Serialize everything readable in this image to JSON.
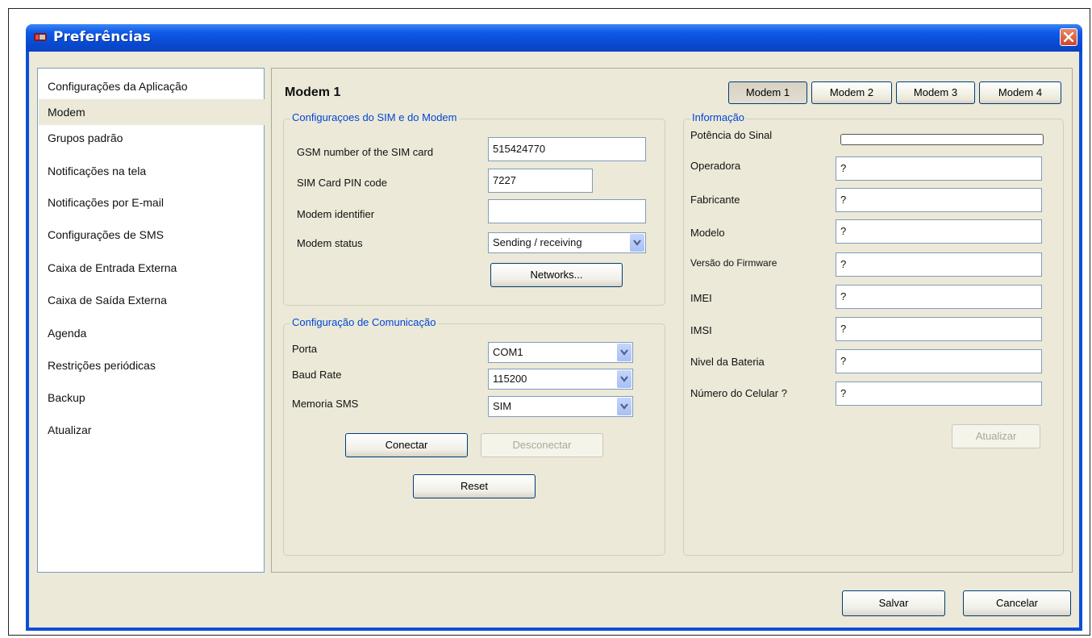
{
  "window": {
    "title": "Preferências"
  },
  "nav": {
    "items": [
      {
        "label": "Configurações da Aplicação"
      },
      {
        "label": "Modem",
        "selected": true
      },
      {
        "label": "Grupos padrão"
      },
      {
        "label": "Notificações na tela"
      },
      {
        "label": "Notificações por E-mail"
      },
      {
        "label": "Configurações de SMS"
      },
      {
        "label": "Caixa de Entrada Externa"
      },
      {
        "label": "Caixa de Saída Externa"
      },
      {
        "label": "Agenda"
      },
      {
        "label": "Restrições periódicas"
      },
      {
        "label": "Backup"
      },
      {
        "label": "Atualizar"
      }
    ]
  },
  "main": {
    "title": "Modem 1",
    "tabs": [
      {
        "label": "Modem 1",
        "active": true
      },
      {
        "label": "Modem 2"
      },
      {
        "label": "Modem 3"
      },
      {
        "label": "Modem 4"
      }
    ]
  },
  "sim_group": {
    "title": "Configuraçoes do SIM e do Modem",
    "gsm_label": "GSM number of the SIM card",
    "gsm_value": "515424770",
    "pin_label": "SIM Card PIN code",
    "pin_value": "7227",
    "modem_id_label": "Modem identifier",
    "modem_id_value": "",
    "status_label": "Modem status",
    "status_value": "Sending / receiving",
    "networks_button": "Networks..."
  },
  "comm_group": {
    "title": "Configuração de Comunicação",
    "port_label": "Porta",
    "port_value": "COM1",
    "baud_label": "Baud Rate",
    "baud_value": "115200",
    "memory_label": "Memoria SMS",
    "memory_value": "SIM",
    "connect_button": "Conectar",
    "disconnect_button": "Desconectar",
    "reset_button": "Reset"
  },
  "info_group": {
    "title": "Informação",
    "signal_label": "Potência do Sinal",
    "signal_level": 0,
    "rows": [
      {
        "label": "Operadora",
        "value": "?"
      },
      {
        "label": "Fabricante",
        "value": "?"
      },
      {
        "label": "Modelo",
        "value": "?"
      },
      {
        "label": "Versão do Firmware",
        "value": "?"
      },
      {
        "label": "IMEI",
        "value": "?"
      },
      {
        "label": "IMSI",
        "value": "?"
      },
      {
        "label": "Nivel da Bateria",
        "value": "?"
      },
      {
        "label": "Número do Celular ?",
        "value": "?"
      }
    ],
    "update_button": "Atualizar"
  },
  "footer": {
    "save_button": "Salvar",
    "cancel_button": "Cancelar"
  },
  "colors": {
    "titlebar": "#0b4fd8",
    "group_label": "#0046d5",
    "client_bg": "#ece9d8"
  }
}
